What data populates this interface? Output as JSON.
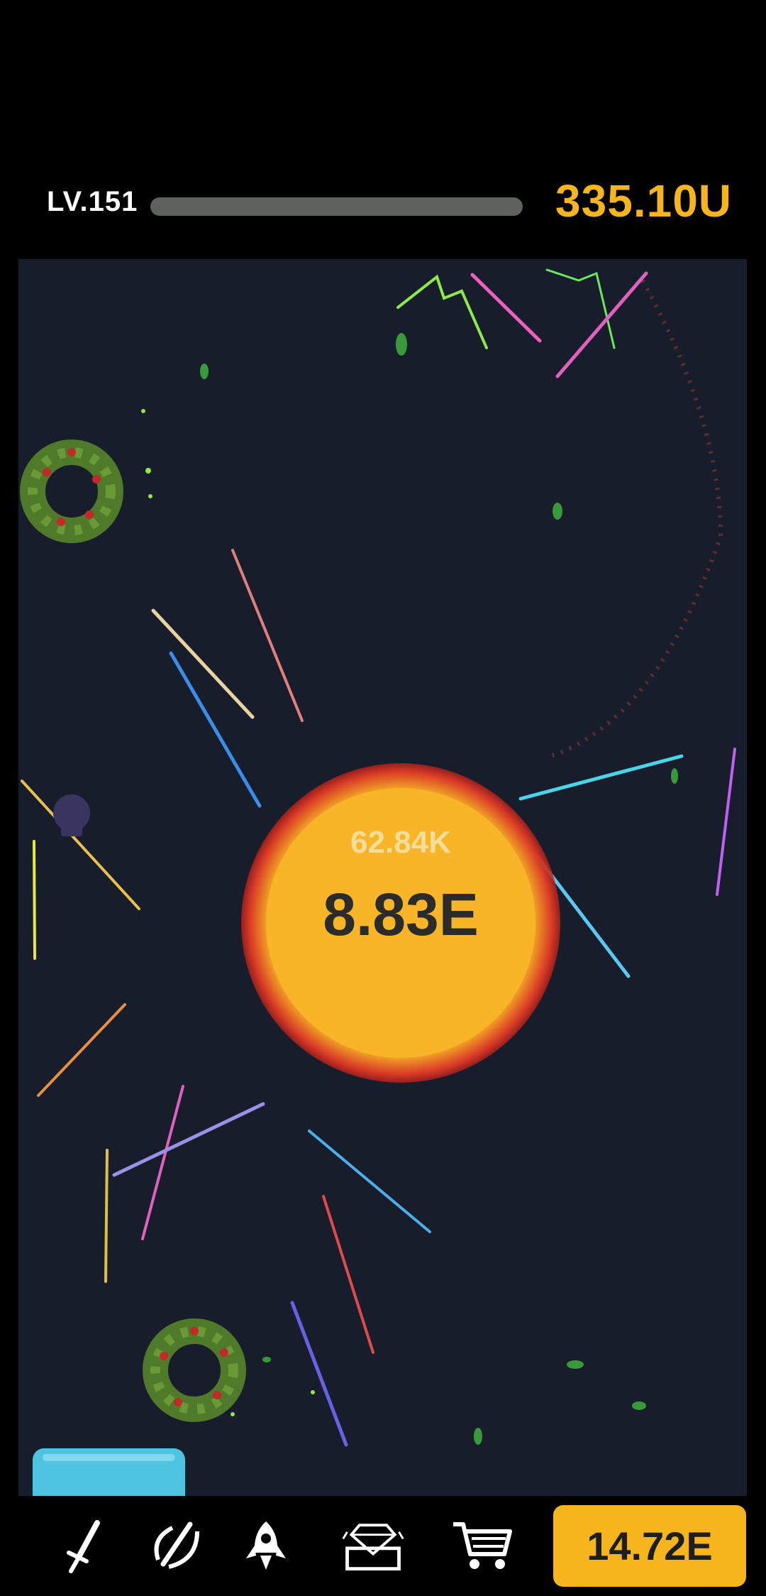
{
  "hud": {
    "level_label": "LV.151",
    "level_progress": 0.0,
    "currency": "335.10U"
  },
  "target": {
    "damage_popup": "62.84K",
    "hp_value": "8.83E"
  },
  "bottom_nav": {
    "items": [
      {
        "icon": "sword-icon"
      },
      {
        "icon": "sword-slash-icon"
      },
      {
        "icon": "rocket-icon"
      },
      {
        "icon": "gem-chest-icon"
      },
      {
        "icon": "shopping-cart-icon"
      }
    ],
    "buy_label": "14.72E"
  },
  "colors": {
    "gold": "#f6b51d",
    "arena_bg": "#171d2b",
    "sun": "#f7b527",
    "sun_glow": "#d83a26"
  }
}
